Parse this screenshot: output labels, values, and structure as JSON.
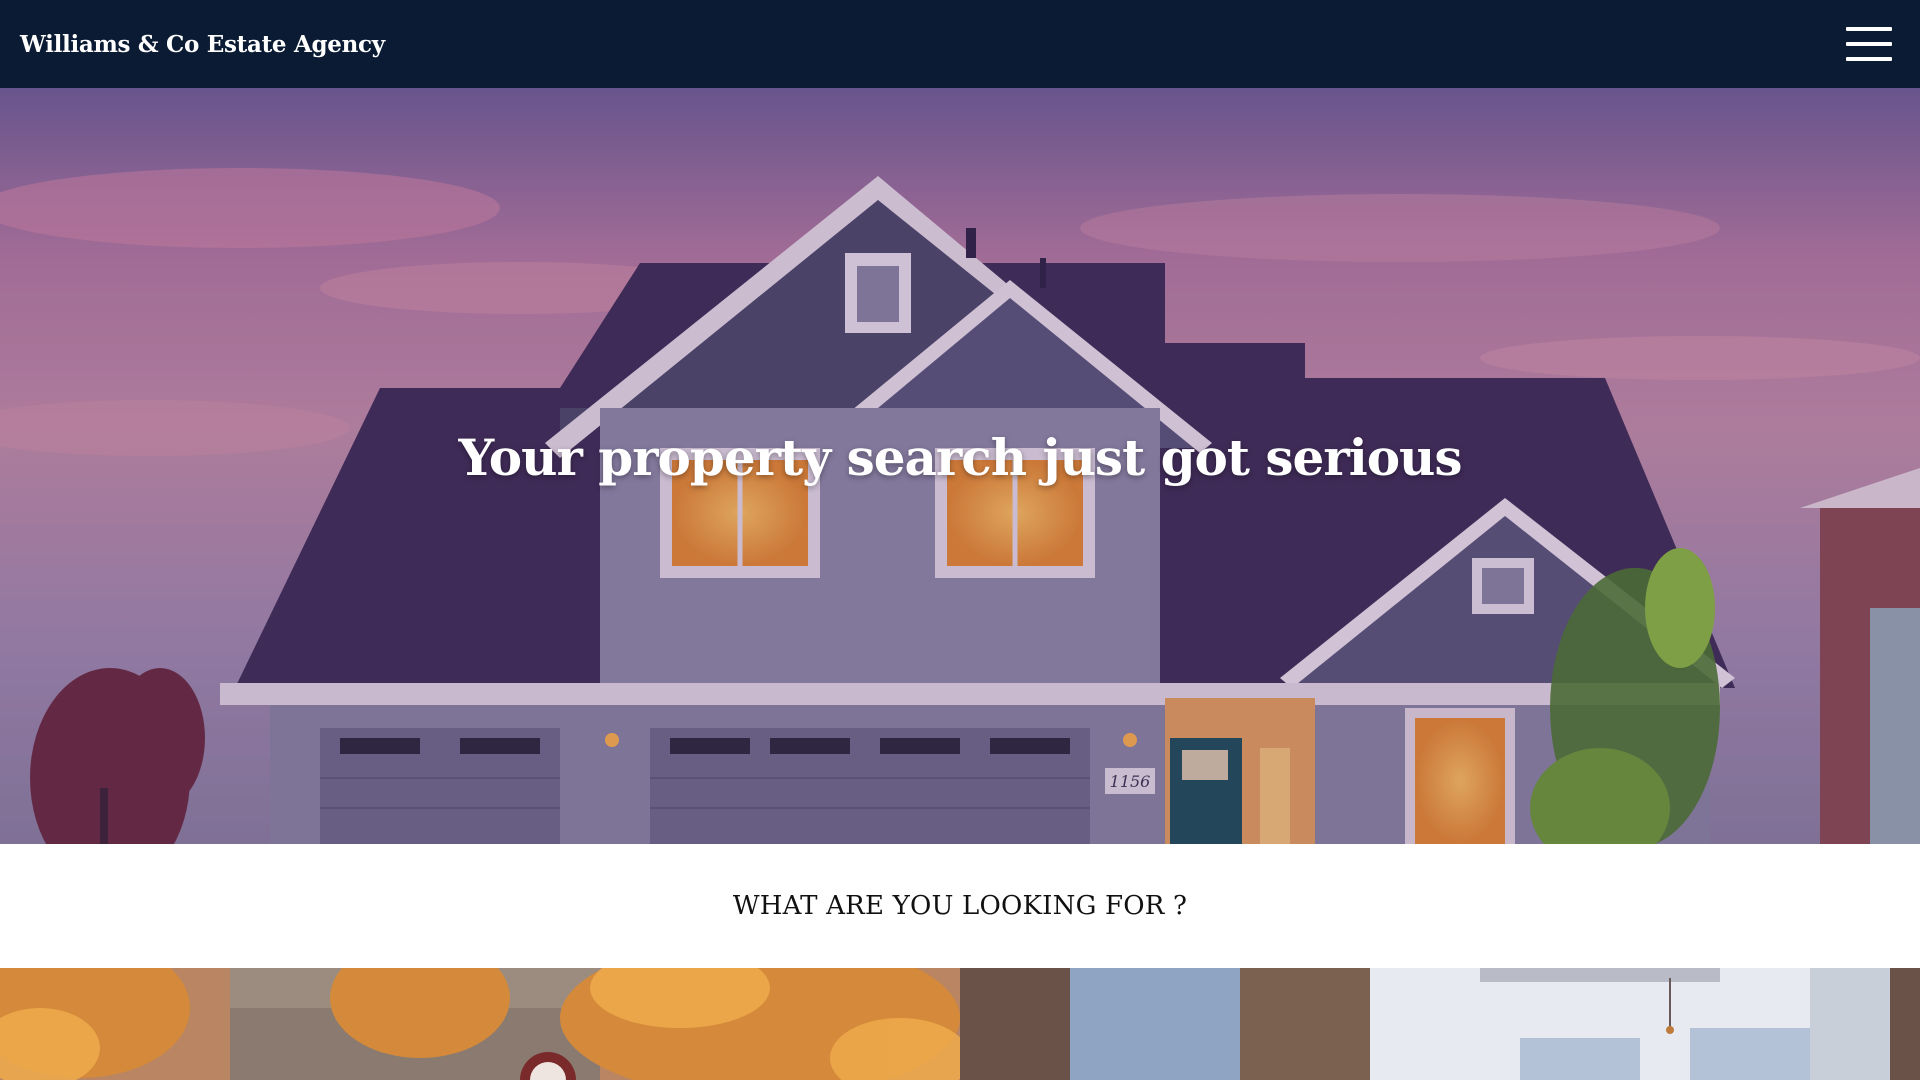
{
  "navbar": {
    "brand": "Williams & Co Estate Agency",
    "menu_icon": "hamburger-menu-icon"
  },
  "hero": {
    "title": "Your property search just got serious",
    "house_number": "1156"
  },
  "looking_for": {
    "heading": "WHAT ARE YOU LOOKING FOR ?"
  },
  "tiles": [
    {
      "name": "houses-tile"
    },
    {
      "name": "apartments-tile"
    }
  ],
  "colors": {
    "navbar_bg": "#0b1b34",
    "text_light": "#ffffff",
    "heading_dark": "#111111"
  }
}
